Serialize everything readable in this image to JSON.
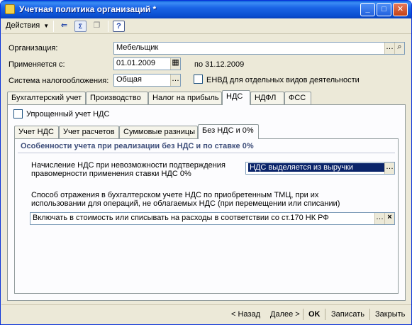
{
  "window": {
    "title": "Учетная политика организаций *",
    "controls": {
      "minimize": "_",
      "maximize": "□",
      "close": "✕"
    }
  },
  "toolbar": {
    "actions_label": "Действия",
    "help_label": "?"
  },
  "form": {
    "org_label": "Организация:",
    "org_value": "Мебельщик",
    "date_label": "Применяется с:",
    "date_value": "01.01.2009",
    "date_to": "по 31.12.2009",
    "tax_label": "Система налогообложения:",
    "tax_value": "Общая",
    "envd_label": "ЕНВД для отдельных видов деятельности"
  },
  "tabs": [
    {
      "label": "Бухгалтерский учет"
    },
    {
      "label": "Производство"
    },
    {
      "label": "Налог на прибыль"
    },
    {
      "label": "НДС"
    },
    {
      "label": "НДФЛ"
    },
    {
      "label": "ФСС"
    }
  ],
  "vat": {
    "simplified_label": "Упрощенный учет НДС",
    "subtabs": [
      {
        "label": "Учет НДС"
      },
      {
        "label": "Учет расчетов"
      },
      {
        "label": "Суммовые разницы"
      },
      {
        "label": "Без НДС и 0%"
      }
    ],
    "section_title": "Особенности учета при реализации без НДС и по ставке 0%",
    "charge_label_1": "Начисление НДС при невозможности подтверждения",
    "charge_label_2": "правомерности применения ставки НДС 0%",
    "charge_value": "НДС выделяется из выручки",
    "method_label_1": "Способ отражения в бухгалтерском учете НДС по приобретенным ТМЦ, при их",
    "method_label_2": "использовании для операций, не облагаемых НДС (при перемещении или списании)",
    "method_value": "Включать в стоимость или списывать на расходы в соответствии со ст.170 НК РФ"
  },
  "footer": {
    "back": "< Назад",
    "next": "Далее >",
    "ok": "OK",
    "write": "Записать",
    "close": "Закрыть"
  },
  "colors": {
    "title_bar": "#0a4fd0",
    "selection": "#0a246a",
    "window_bg": "#ece9d8"
  }
}
